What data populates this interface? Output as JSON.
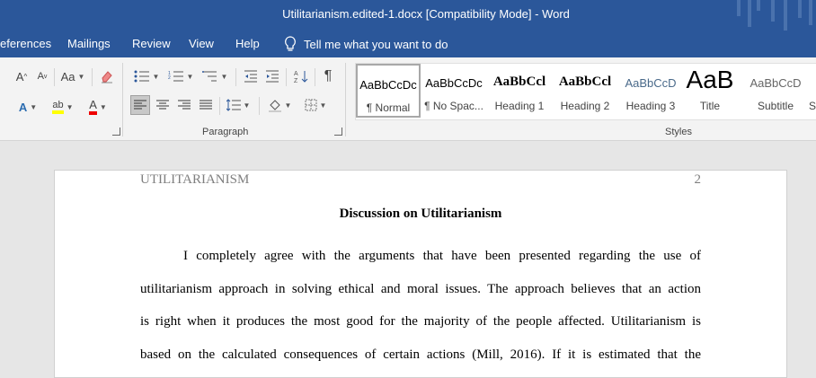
{
  "titlebar": {
    "title": "Utilitarianism.edited-1.docx  [Compatibility Mode]  -  Word"
  },
  "tabs": [
    "eferences",
    "Mailings",
    "Review",
    "View",
    "Help"
  ],
  "tellme": {
    "label": "Tell me what you want to do",
    "icon": "lightbulb-icon"
  },
  "font_group": {
    "grow": "A",
    "shrink": "A",
    "case": "Aa",
    "font_color": "A"
  },
  "paragraph_group": {
    "label": "Paragraph",
    "pilcrow": "¶"
  },
  "styles_group": {
    "label": "Styles"
  },
  "styles": [
    {
      "preview": "AaBbCcDc",
      "name": "¶ Normal",
      "selected": true
    },
    {
      "preview": "AaBbCcDc",
      "name": "¶ No Spac..."
    },
    {
      "preview": "AaBbCcl",
      "name": "Heading 1"
    },
    {
      "preview": "AaBbCcl",
      "name": "Heading 2"
    },
    {
      "preview": "AaBbCcD",
      "name": "Heading 3"
    },
    {
      "preview": "AaB",
      "name": "Title"
    },
    {
      "preview": "AaBbCcD",
      "name": "Subtitle"
    },
    {
      "preview": "",
      "name": "S"
    }
  ],
  "document": {
    "header": "UTILITARIANISM",
    "page_number": "2",
    "title": "Discussion on Utilitarianism",
    "lines": [
      "I completely agree with the arguments that have been presented regarding the use of",
      "utilitarianism approach in solving ethical and moral issues. The approach believes that an action",
      "is right when it produces the most good for the majority of the people affected. Utilitarianism is",
      "based on the calculated consequences of certain actions (Mill, 2016). If it is estimated that the"
    ]
  }
}
